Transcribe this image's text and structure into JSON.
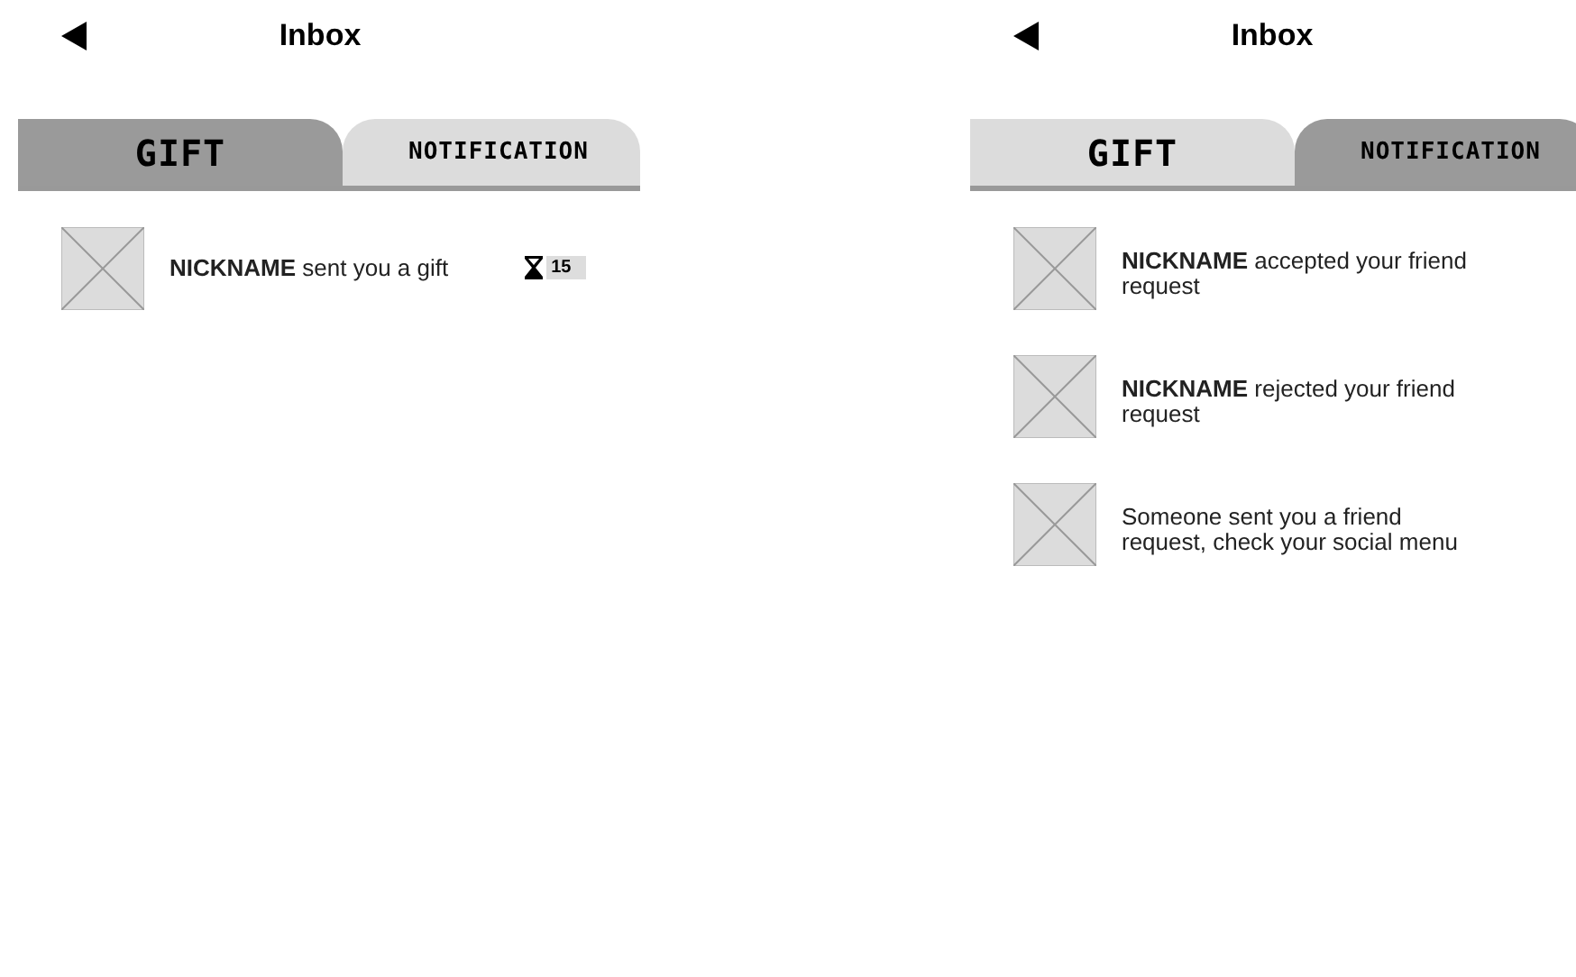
{
  "screens": [
    {
      "title": "Inbox",
      "tabs": [
        {
          "label": "GIFT",
          "selected": true
        },
        {
          "label": "NOTIFICATION",
          "selected": false
        }
      ],
      "items": [
        {
          "kind": "gift",
          "message": "**NICKNAME** sent you a gift",
          "timer": "15"
        }
      ]
    },
    {
      "title": "Inbox",
      "tabs": [
        {
          "label": "GIFT",
          "selected": false
        },
        {
          "label": "NOTIFICATION",
          "selected": true
        }
      ],
      "items": [
        {
          "kind": "notice",
          "message": "**NICKNAME** accepted your friend request"
        },
        {
          "kind": "notice",
          "message": "**NICKNAME** rejected your friend request"
        },
        {
          "kind": "notice",
          "message": "Someone sent you a friend request, check your social menu"
        }
      ]
    }
  ]
}
